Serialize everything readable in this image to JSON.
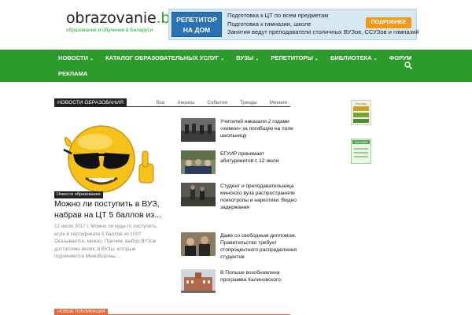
{
  "header": {
    "logo_title": "obrazovanie",
    "logo_domain": ".by",
    "logo_subtitle": "образование и обучение в Беларуси"
  },
  "banner": {
    "badge_line1": "РЕПЕТИТОР",
    "badge_line2": "НА ДОМ",
    "line1": "Подготовка к ЦТ по всем предметам",
    "line2": "Подготовка к гимназии, школе",
    "line3": "Занятия ведут преподаватели столичных ВУЗов, ССУЗов и гимназий",
    "button": "ПОДРОБНЕЕ"
  },
  "nav": {
    "items": [
      {
        "label": "НОВОСТИ",
        "caret": "⌄"
      },
      {
        "label": "КАТАЛОГ ОБРАЗОВАТЕЛЬНЫХ УСЛУГ",
        "caret": "⌄"
      },
      {
        "label": "ВУЗЫ",
        "caret": "⌄"
      },
      {
        "label": "РЕПЕТИТОРЫ",
        "caret": "⌄"
      },
      {
        "label": "БИБЛИОТЕКА",
        "caret": "⌄"
      },
      {
        "label": "ФОРУМ",
        "caret": ""
      },
      {
        "label": "РЕКЛАМА",
        "caret": ""
      }
    ],
    "search_icon": "search-icon"
  },
  "block": {
    "title": "НОВОСТИ ОБРАЗОВАНИЯ",
    "tabs": [
      "Все",
      "Анонсы",
      "События",
      "Тренды",
      "Мнения"
    ]
  },
  "featured": {
    "category": "Новости образования",
    "title": "Можно ли поступить в ВУЗ, набрав на ЦТ 5 баллов из...",
    "excerpt": "12 июля 2017 г. Можно ли куда-то поступить, если в сертификате 5 баллов из 100? Оказывается, можно. Причем, выбор ВУЗов достаточно велик: в ВУЗы, которые подчиняются Минобороны,..."
  },
  "list": [
    {
      "title": "Учителей наказали 2 годами «химии» за погибшую на поле школьницу"
    },
    {
      "title": "БГУИР принимает абитуриентов с 12 июля"
    },
    {
      "title": "Студент и преподавательница минского вуза распространяли психотропы и наркотики. Видео задержания"
    },
    {
      "title": "Даже со свободным дипломом. Правительство требует стопроцентного распределения студентов"
    },
    {
      "title": "В Польше возобновлена программа Калиновского"
    }
  ],
  "sidebar": {
    "ad1_label": "Реклама",
    "ad2_label": "ЭКОЛАЙН"
  },
  "bottom": {
    "title": "НОВЫЕ ПУБЛИКАЦИИ"
  },
  "colors": {
    "nav_green": "#2c9b2c",
    "logo_green": "#2aa52a",
    "banner_blue": "#2a72b5",
    "button_orange": "#f19a1a",
    "bottom_orange": "#e46a3b"
  }
}
